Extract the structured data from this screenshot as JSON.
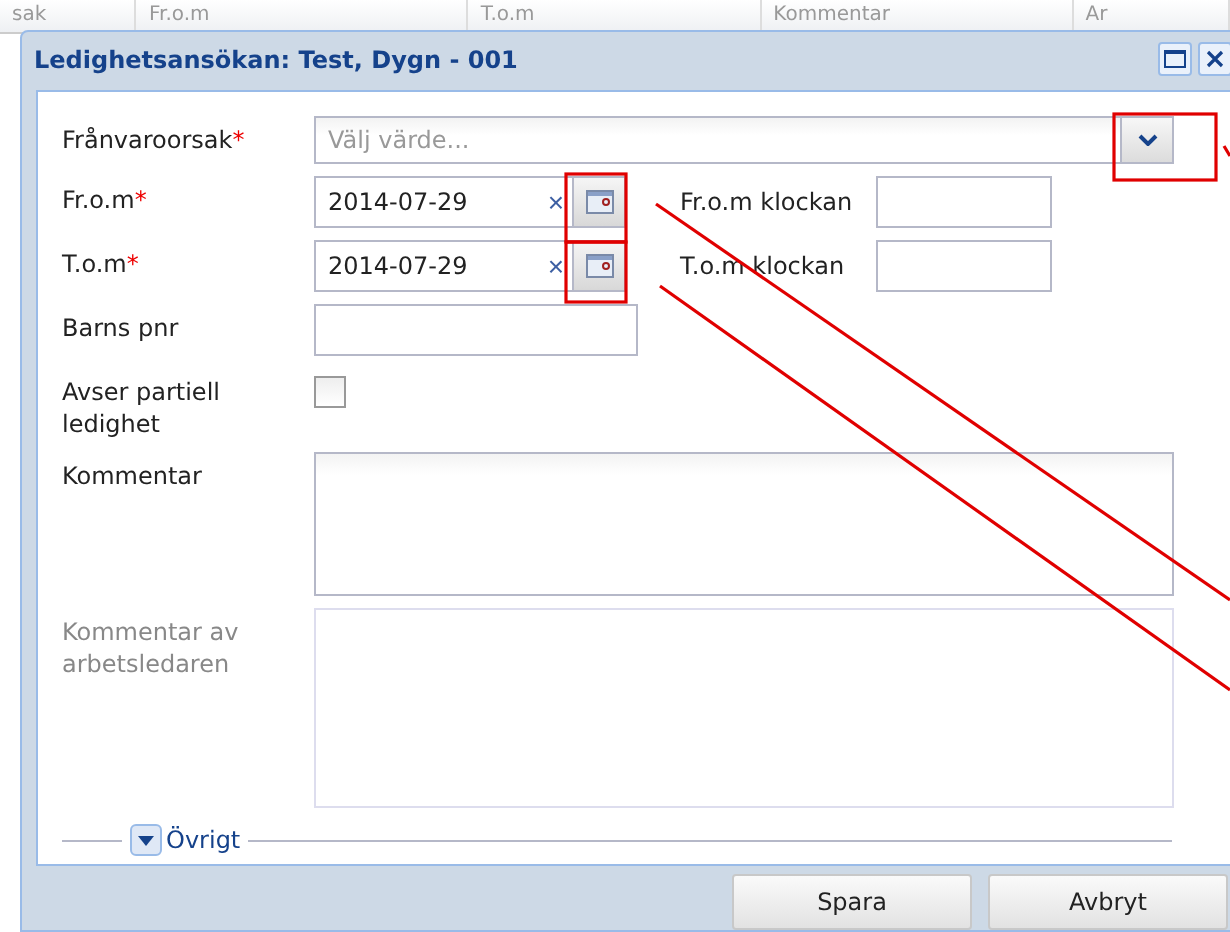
{
  "background_grid": {
    "columns": [
      "sak",
      "Fr.o.m",
      "T.o.m",
      "Kommentar",
      "Ar"
    ]
  },
  "window": {
    "title": "Ledighetsansökan: Test, Dygn - 001"
  },
  "form": {
    "absence_reason": {
      "label": "Frånvaroorsak",
      "required_mark": "*",
      "placeholder": "Välj värde..."
    },
    "from_date": {
      "label": "Fr.o.m",
      "required_mark": "*",
      "value": "2014-07-29",
      "clear": "×"
    },
    "to_date": {
      "label": "T.o.m",
      "required_mark": "*",
      "value": "2014-07-29",
      "clear": "×"
    },
    "from_time": {
      "label": "Fr.o.m klockan"
    },
    "to_time": {
      "label": "T.o.m klockan"
    },
    "child_id": {
      "label": "Barns pnr"
    },
    "partial": {
      "label": "Avser partiell ledighet",
      "checked": false
    },
    "comment": {
      "label": "Kommentar",
      "disabled": false
    },
    "supervisor_comment": {
      "label": "Kommentar av arbetsledaren",
      "disabled": true
    },
    "section": {
      "label": "Övrigt",
      "expanded": false
    }
  },
  "buttons": [
    "Spara",
    "Avbryt"
  ]
}
